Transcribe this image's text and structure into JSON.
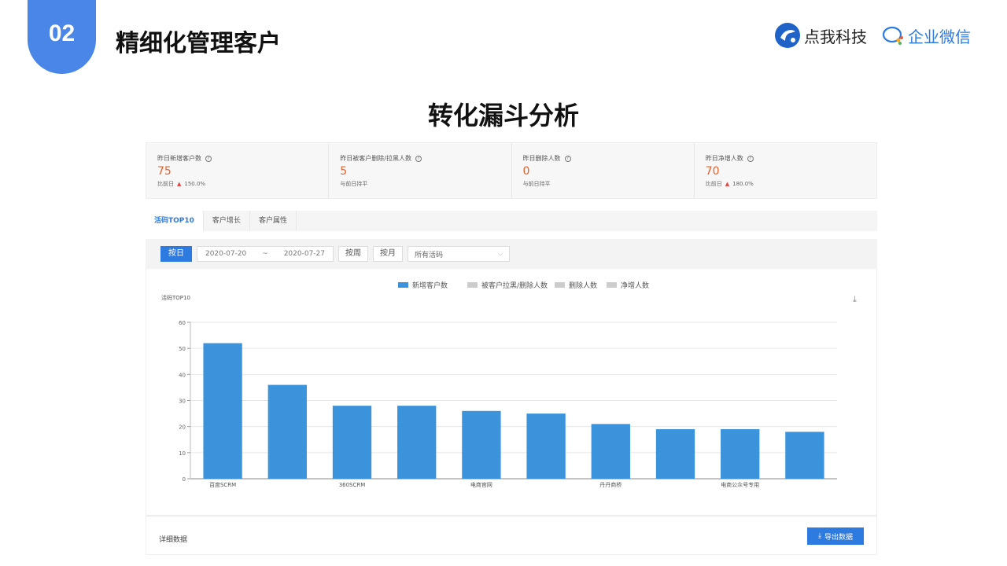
{
  "slide": {
    "number": "02",
    "title": "精细化管理客户",
    "main_title": "转化漏斗分析",
    "brand1": "点我科技",
    "brand2": "企业微信"
  },
  "stats": [
    {
      "label": "昨日新增客户数",
      "value": "75",
      "compare": "比前日",
      "arrow": true,
      "change": "150.0%"
    },
    {
      "label": "昨日被客户删除/拉黑人数",
      "value": "5",
      "compare": "与前日持平",
      "arrow": false,
      "change": ""
    },
    {
      "label": "昨日删除人数",
      "value": "0",
      "compare": "与前日持平",
      "arrow": false,
      "change": ""
    },
    {
      "label": "昨日净增人数",
      "value": "70",
      "compare": "比前日",
      "arrow": true,
      "change": "180.0%"
    }
  ],
  "tabs": [
    {
      "label": "活码TOP10",
      "active": true
    },
    {
      "label": "客户增长",
      "active": false
    },
    {
      "label": "客户属性",
      "active": false
    }
  ],
  "toolbar": {
    "by_day": "按日",
    "date_from": "2020-07-20",
    "date_sep": "~",
    "date_to": "2020-07-27",
    "by_week": "按周",
    "by_month": "按月",
    "select_value": "所有活码"
  },
  "chart_data": {
    "type": "bar",
    "title": "活码TOP10",
    "legend": [
      "新增客户数",
      "被客户拉黑/删除人数",
      "删除人数",
      "净增人数"
    ],
    "legend_placement": "top-center",
    "categories": [
      "百度SCRM",
      "",
      "360SCRM",
      "",
      "电商官网",
      "",
      "丹丹商桥",
      "",
      "电商公众号专用",
      ""
    ],
    "series": [
      {
        "name": "新增客户数",
        "values": [
          52,
          36,
          28,
          28,
          26,
          25,
          21,
          19,
          19,
          18
        ]
      }
    ],
    "ylim": [
      0,
      60
    ],
    "yticks": [
      0,
      10,
      20,
      30,
      40,
      50,
      60
    ],
    "grid": true,
    "colors": {
      "bar": "#3b93db",
      "legend_inactive": "#cccccc"
    }
  },
  "detail": {
    "label": "详细数据",
    "export_label": "导出数据"
  }
}
